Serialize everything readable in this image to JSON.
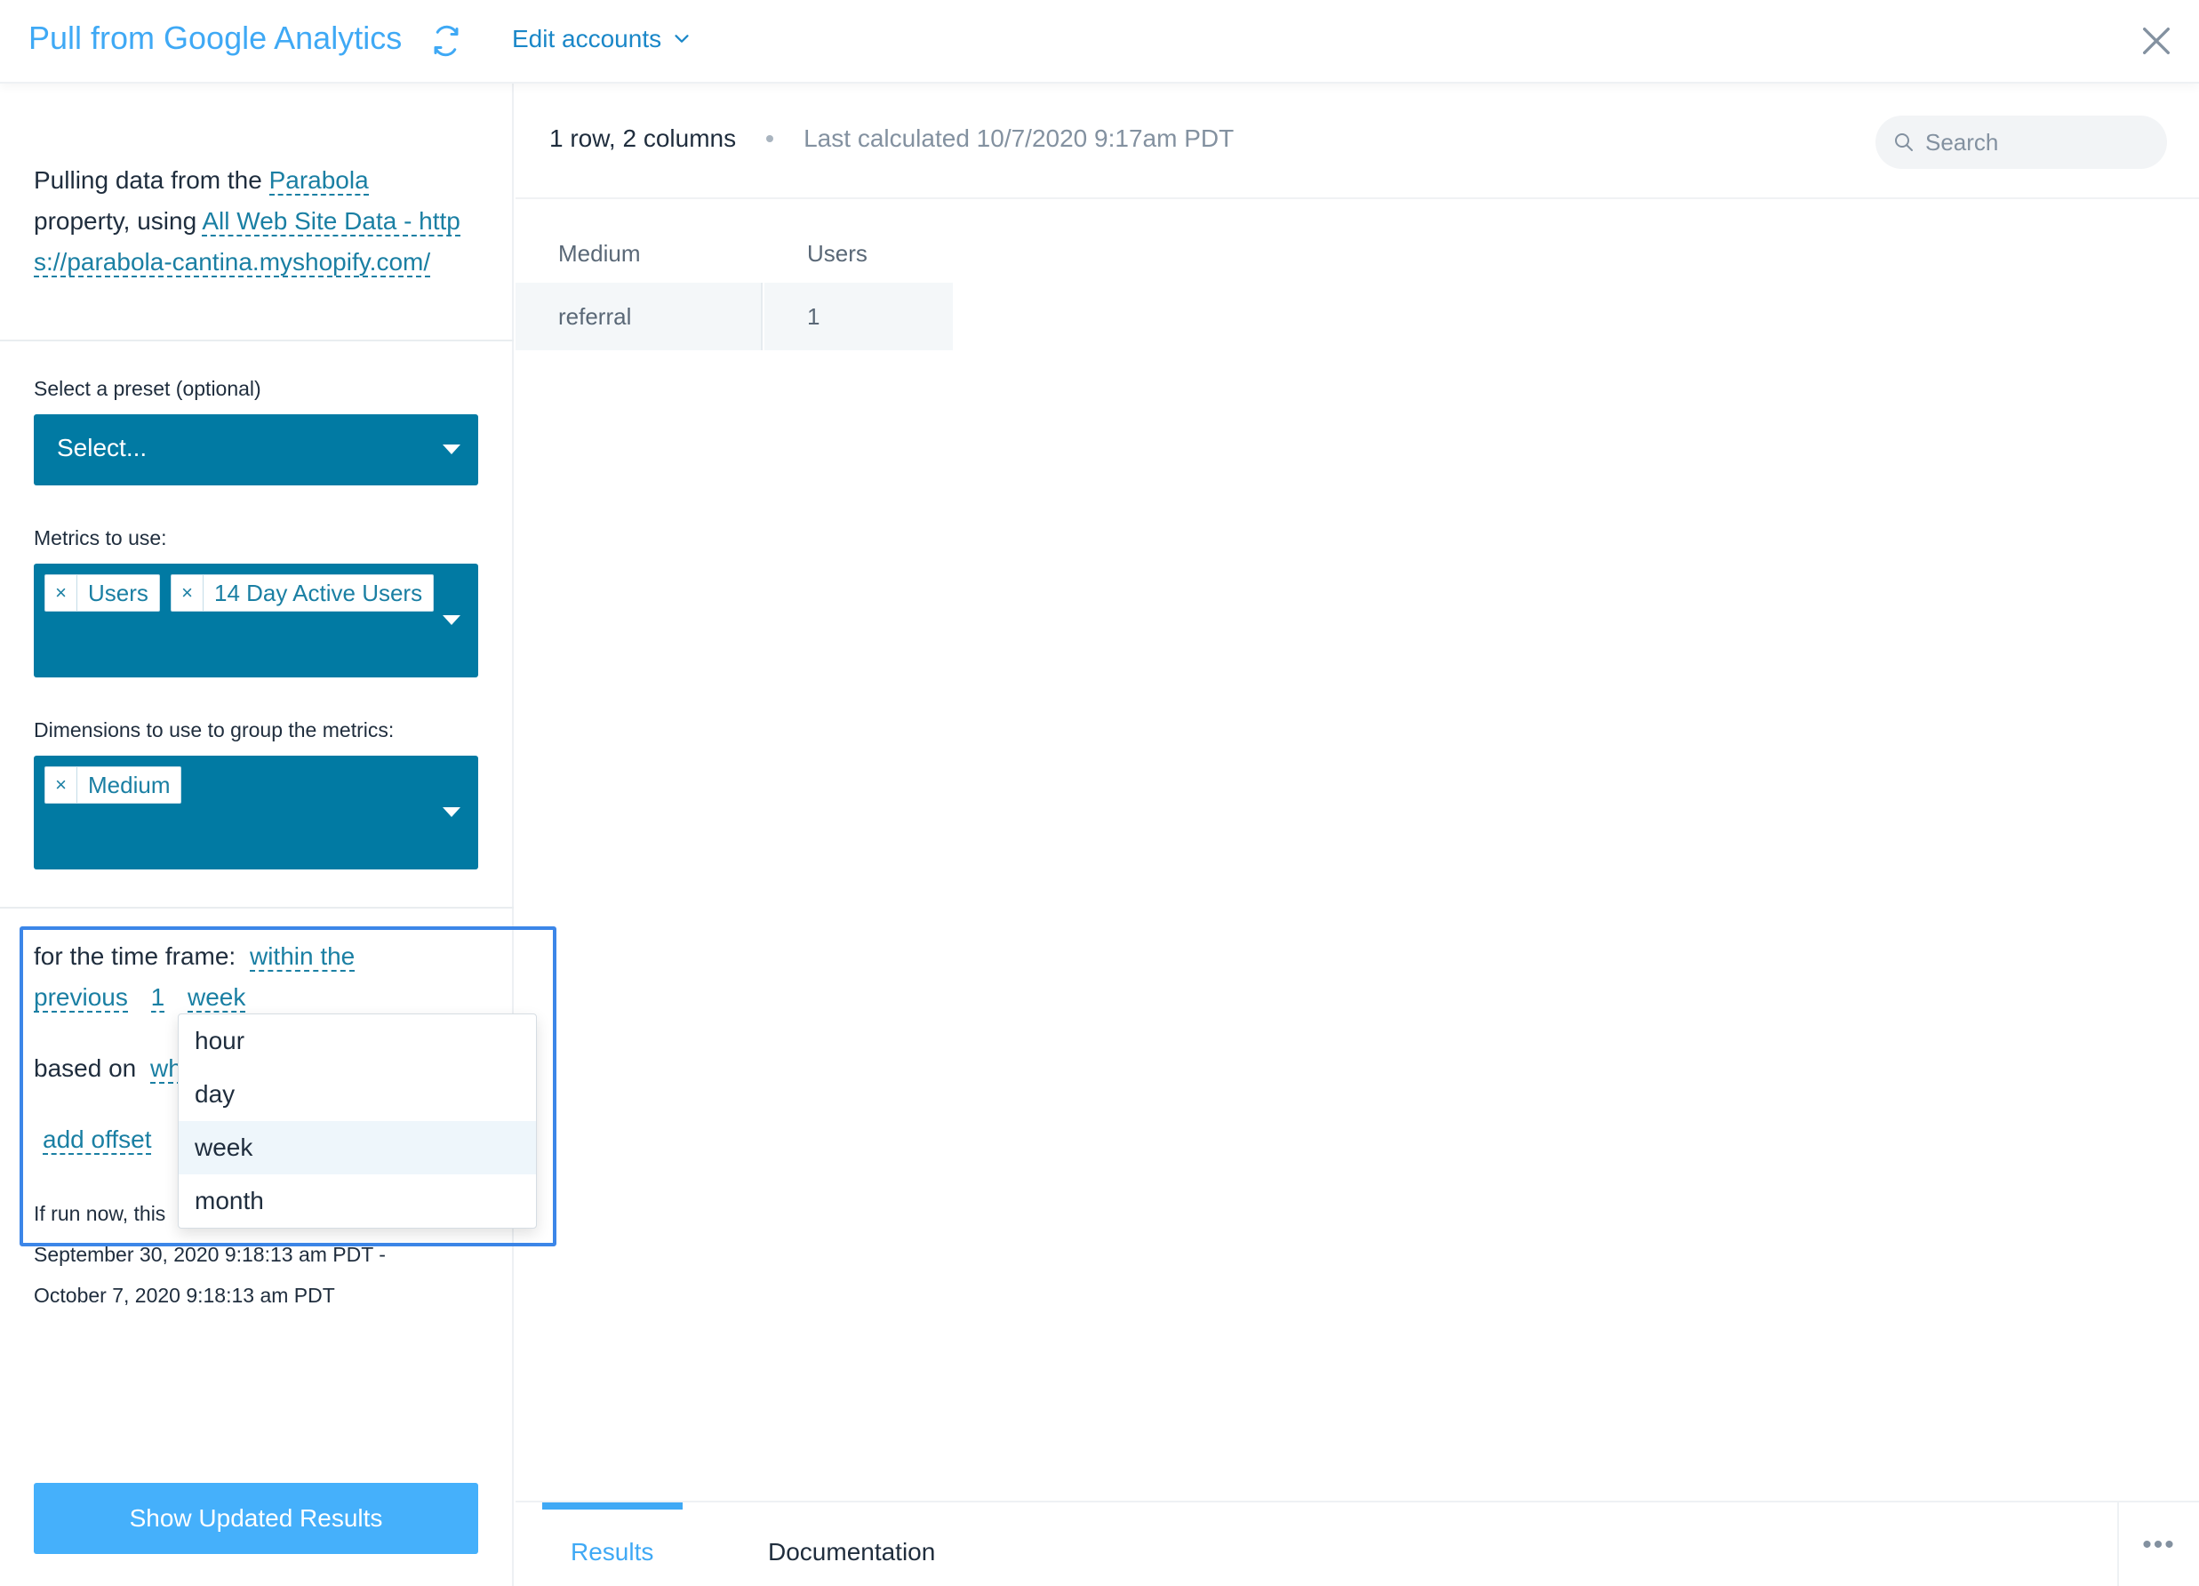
{
  "header": {
    "title": "Pull from Google Analytics",
    "edit_accounts_label": "Edit accounts"
  },
  "left": {
    "source": {
      "prefix": "Pulling data from the ",
      "property_name": "Parabola",
      "middle": " property, using ",
      "view_name": "All Web Site Data - https://parabola-cantina.myshopify.com/"
    },
    "preset": {
      "label": "Select a preset (optional)",
      "placeholder": "Select..."
    },
    "metrics": {
      "label": "Metrics to use:",
      "tags": [
        "Users",
        "14 Day Active Users"
      ]
    },
    "dimensions": {
      "label": "Dimensions to use to group the metrics:",
      "tags": [
        "Medium"
      ]
    },
    "timeframe": {
      "prefix": "for the time frame:",
      "mode": "within the",
      "direction": "previous",
      "amount": "1",
      "unit": "week",
      "based_on_prefix": "based on",
      "based_on_value": "wh",
      "add_offset": "add offset",
      "run_now_prefix": "If run now, this",
      "run_now_range_start": "September 30, 2020 9:18:13 am PDT -",
      "run_now_range_end": "October 7, 2020 9:18:13 am PDT"
    },
    "unit_dropdown": {
      "options": [
        "hour",
        "day",
        "week",
        "month"
      ],
      "selected": "week"
    },
    "show_results_button": "Show Updated Results"
  },
  "right": {
    "summary": "1 row, 2 columns",
    "last_calculated": "Last calculated 10/7/2020 9:17am PDT",
    "search_placeholder": "Search",
    "table": {
      "columns": [
        "Medium",
        "Users"
      ],
      "rows": [
        [
          "referral",
          "1"
        ]
      ]
    },
    "tabs": [
      "Results",
      "Documentation"
    ],
    "active_tab": "Results"
  },
  "colors": {
    "accent": "#3fa9f5",
    "select_bg": "#017aa3",
    "link": "#1a7fa3",
    "highlight": "#3c86e8",
    "button": "#45b0fb"
  }
}
